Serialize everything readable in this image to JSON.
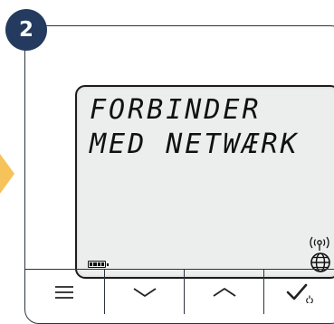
{
  "step_badge": "2",
  "display": {
    "line1": "FORBINDER",
    "line2": "MED NETWÆRK"
  },
  "status_icons": [
    "battery-icon",
    "wifi-signal-icon",
    "globe-icon"
  ],
  "buttons": [
    {
      "name": "menu-button",
      "icon": "hamburger-icon"
    },
    {
      "name": "down-button",
      "icon": "chevron-down-icon"
    },
    {
      "name": "up-button",
      "icon": "chevron-up-icon"
    },
    {
      "name": "confirm-button",
      "icon": "check-power-icon"
    }
  ],
  "colors": {
    "badge": "#243a5e",
    "side_arrow": "#f6c25a",
    "lcd_background": "#eceded",
    "outline": "#2e3340"
  }
}
